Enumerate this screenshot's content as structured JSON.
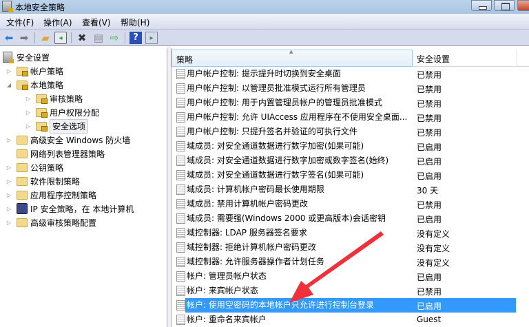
{
  "window": {
    "title": "本地安全策略"
  },
  "menu": [
    "文件(F)",
    "操作(A)",
    "查看(V)",
    "帮助(H)"
  ],
  "toolbar": {
    "icons": [
      "back-icon",
      "forward-icon",
      "up-folder-icon",
      "show-hide-tree-icon",
      "delete-icon",
      "properties-icon",
      "export-list-icon",
      "help-icon",
      "show-action-pane-icon"
    ]
  },
  "tree": [
    {
      "label": "安全设置",
      "level": 0,
      "expander": "",
      "icon": "server"
    },
    {
      "label": "帐户策略",
      "level": 1,
      "expander": "collapsed",
      "icon": "folder-lock"
    },
    {
      "label": "本地策略",
      "level": 1,
      "expander": "expanded",
      "icon": "folder-lock"
    },
    {
      "label": "审核策略",
      "level": 2,
      "expander": "collapsed",
      "icon": "folder-lock"
    },
    {
      "label": "用户权限分配",
      "level": 2,
      "expander": "collapsed",
      "icon": "folder-lock"
    },
    {
      "label": "安全选项",
      "level": 2,
      "expander": "collapsed",
      "icon": "folder-lock",
      "selected": true
    },
    {
      "label": "高级安全 Windows 防火墙",
      "level": 1,
      "expander": "collapsed",
      "icon": "folder"
    },
    {
      "label": "网络列表管理器策略",
      "level": 1,
      "expander": "",
      "icon": "folder"
    },
    {
      "label": "公钥策略",
      "level": 1,
      "expander": "collapsed",
      "icon": "folder"
    },
    {
      "label": "软件限制策略",
      "level": 1,
      "expander": "collapsed",
      "icon": "folder"
    },
    {
      "label": "应用程序控制策略",
      "level": 1,
      "expander": "collapsed",
      "icon": "folder"
    },
    {
      "label": "IP 安全策略，在 本地计算机",
      "level": 1,
      "expander": "collapsed",
      "icon": "ip"
    },
    {
      "label": "高级审核策略配置",
      "level": 1,
      "expander": "collapsed",
      "icon": "folder"
    }
  ],
  "list": {
    "columns": [
      "策略",
      "安全设置"
    ],
    "rows": [
      {
        "policy": "用户帐户控制: 提示提升时切换到安全桌面",
        "setting": "已禁用"
      },
      {
        "policy": "用户帐户控制: 以管理员批准模式运行所有管理员",
        "setting": "已禁用"
      },
      {
        "policy": "用户帐户控制: 用于内置管理员帐户的管理员批准模式",
        "setting": "已禁用"
      },
      {
        "policy": "用户帐户控制: 允许 UIAccess 应用程序在不使用安全桌面...",
        "setting": "已禁用"
      },
      {
        "policy": "用户帐户控制: 只提升签名并验证的可执行文件",
        "setting": "已禁用"
      },
      {
        "policy": "域成员: 对安全通道数据进行数字加密(如果可能)",
        "setting": "已启用"
      },
      {
        "policy": "域成员: 对安全通道数据进行数字加密或数字签名(始终)",
        "setting": "已启用"
      },
      {
        "policy": "域成员: 对安全通道数据进行数字签名(如果可能)",
        "setting": "已启用"
      },
      {
        "policy": "域成员: 计算机帐户密码最长使用期限",
        "setting": "30 天"
      },
      {
        "policy": "域成员: 禁用计算机帐户密码更改",
        "setting": "已禁用"
      },
      {
        "policy": "域成员: 需要强(Windows 2000 或更高版本)会话密钥",
        "setting": "已启用"
      },
      {
        "policy": "域控制器: LDAP 服务器签名要求",
        "setting": "没有定义"
      },
      {
        "policy": "域控制器: 拒绝计算机帐户密码更改",
        "setting": "没有定义"
      },
      {
        "policy": "域控制器: 允许服务器操作者计划任务",
        "setting": "没有定义"
      },
      {
        "policy": "帐户: 管理员帐户状态",
        "setting": "已启用"
      },
      {
        "policy": "帐户: 来宾帐户状态",
        "setting": "已禁用"
      },
      {
        "policy": "帐户: 使用空密码的本地帐户只允许进行控制台登录",
        "setting": "已启用",
        "selected": true
      },
      {
        "policy": "帐户: 重命名来宾帐户",
        "setting": "Guest"
      }
    ]
  },
  "colors": {
    "selection": "#3399ff",
    "annotation_arrow": "#f0303a"
  }
}
